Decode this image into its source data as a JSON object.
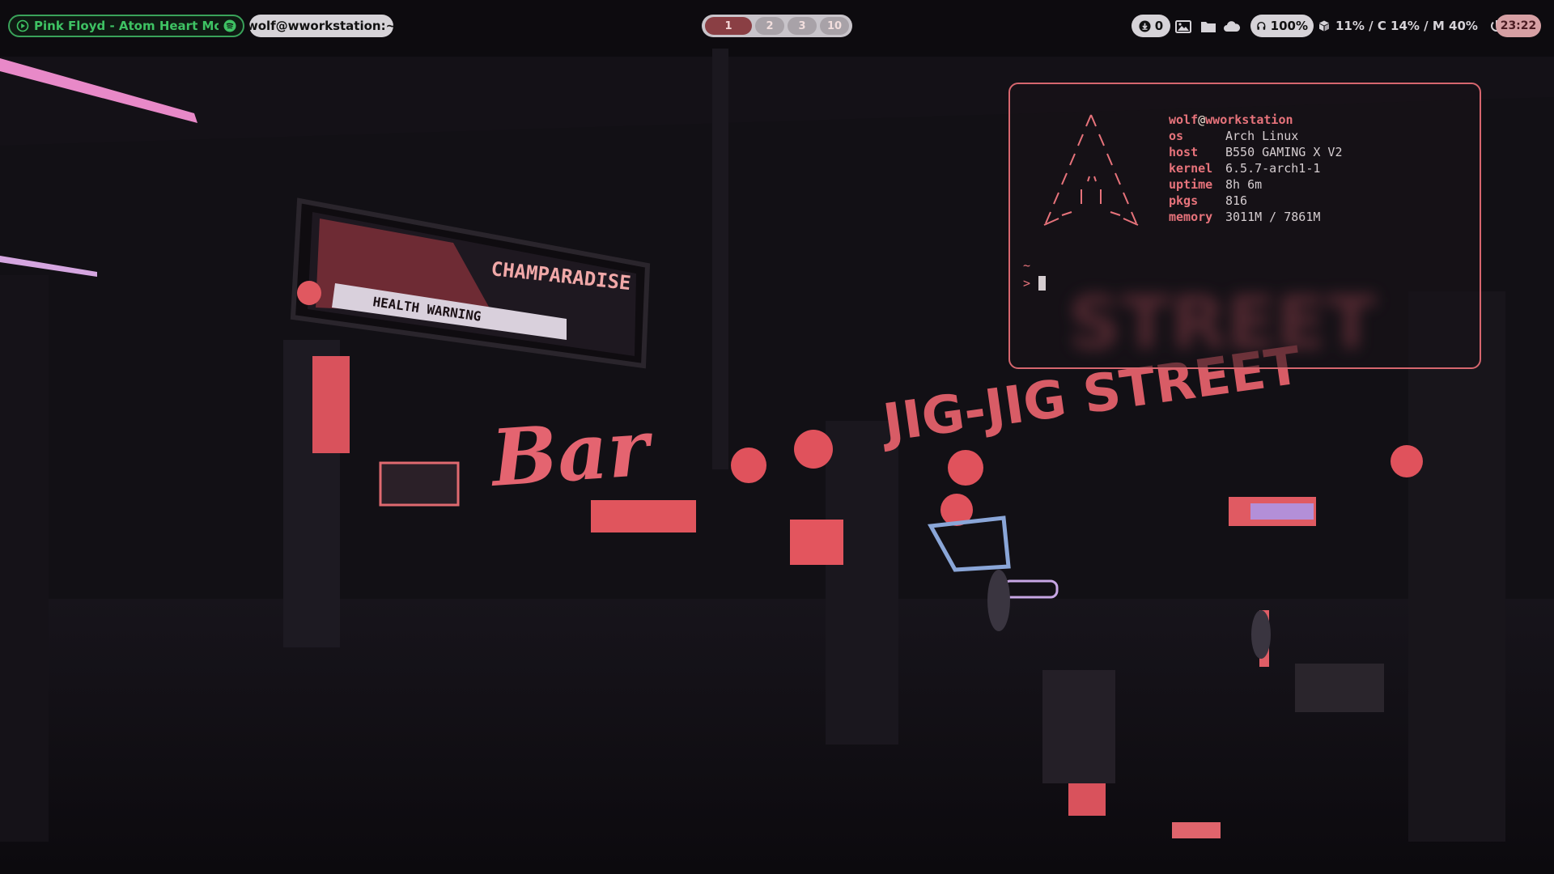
{
  "colors": {
    "accent": "#e7737b",
    "spotify_green": "#3ec263",
    "bar_pill": "#d6d3d8",
    "active_workspace": "#8a3f44"
  },
  "topbar": {
    "media": {
      "icon": "play-circle-icon",
      "text": "Pink Floyd - Atom Heart Mother",
      "source_icon": "spotify-icon"
    },
    "window_title": "wolf@wworkstation:~",
    "workspaces": [
      {
        "label": "1",
        "active": true
      },
      {
        "label": "2",
        "active": false
      },
      {
        "label": "3",
        "active": false
      },
      {
        "label": "10",
        "active": false
      }
    ],
    "updates": {
      "icon": "download-icon",
      "count": "0"
    },
    "tray_icons": [
      "image-icon",
      "folder-icon",
      "cloud-icon"
    ],
    "volume": {
      "icon": "headphones-icon",
      "value": "100%"
    },
    "sysinfo": {
      "icon": "cube-icon",
      "text": "11% / C 14% / M 40%"
    },
    "power_icon": "power-icon",
    "clock": "23:22"
  },
  "wallpaper": {
    "signs": [
      "CHAMPARADISE",
      "HEALTH WARNING",
      "JIG-JIG STREET"
    ]
  },
  "terminal": {
    "user": "wolf",
    "at": "@",
    "host": "wworkstation",
    "info": [
      {
        "key": "os",
        "value": "Arch Linux"
      },
      {
        "key": "host",
        "value": "B550 GAMING X V2"
      },
      {
        "key": "kernel",
        "value": "6.5.7-arch1-1"
      },
      {
        "key": "uptime",
        "value": "8h 6m"
      },
      {
        "key": "pkgs",
        "value": "816"
      },
      {
        "key": "memory",
        "value": "3011M / 7861M"
      }
    ],
    "cwd": "~",
    "prompt": ">"
  }
}
